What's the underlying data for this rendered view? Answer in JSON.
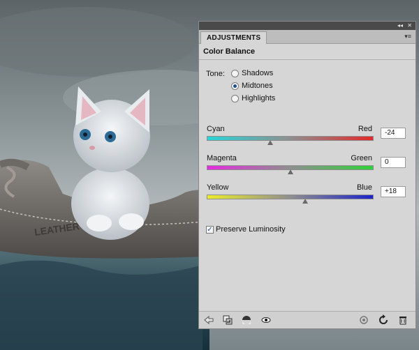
{
  "panel": {
    "tab_label": "ADJUSTMENTS",
    "title": "Color Balance",
    "tone": {
      "label": "Tone:",
      "options": [
        {
          "label": "Shadows",
          "selected": false
        },
        {
          "label": "Midtones",
          "selected": true
        },
        {
          "label": "Highlights",
          "selected": false
        }
      ]
    },
    "sliders": [
      {
        "left_label": "Cyan",
        "right_label": "Red",
        "value": "-24",
        "level": -24,
        "colors": [
          "#27d5d8",
          "#e32a2a"
        ]
      },
      {
        "left_label": "Magenta",
        "right_label": "Green",
        "value": "0",
        "level": 0,
        "colors": [
          "#e52ae0",
          "#2fd23a"
        ]
      },
      {
        "left_label": "Yellow",
        "right_label": "Blue",
        "value": "+18",
        "level": 18,
        "colors": [
          "#ecec2a",
          "#1e24c8"
        ]
      }
    ],
    "preserve_luminosity": {
      "label": "Preserve Luminosity",
      "checked": true
    },
    "footer_icons": [
      "back-arrow-icon",
      "clip-to-layer-icon",
      "visibility-mask-icon",
      "eye-icon",
      "previous-state-icon",
      "reset-icon",
      "trash-icon"
    ]
  },
  "artwork": {
    "shoe_text": "LEATHER"
  }
}
